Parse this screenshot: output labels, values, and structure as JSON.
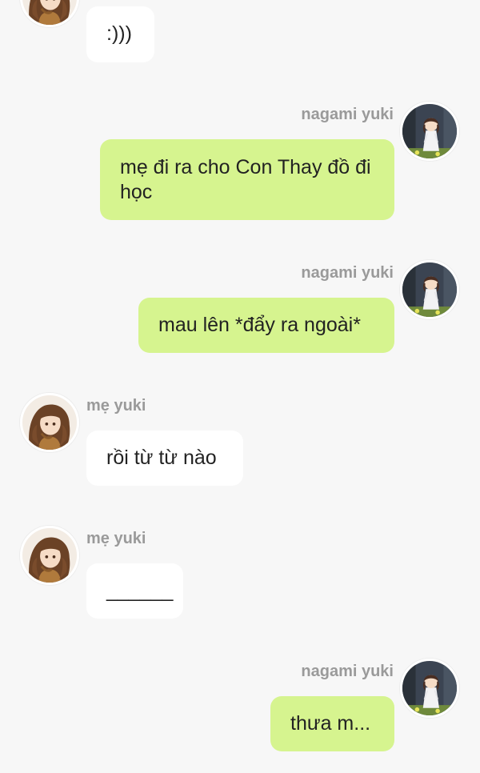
{
  "messages": [
    {
      "sender": "",
      "side": "left",
      "text": ":)))"
    },
    {
      "sender": "nagami yuki",
      "side": "right",
      "text": "mẹ đi ra cho Con Thay đồ đi học"
    },
    {
      "sender": "nagami yuki",
      "side": "right",
      "text": "mau lên *đẩy ra ngoài*"
    },
    {
      "sender": "mẹ yuki",
      "side": "left",
      "text": "rồi từ từ nào"
    },
    {
      "sender": "mẹ yuki",
      "side": "left",
      "text": "______"
    },
    {
      "sender": "nagami yuki",
      "side": "right",
      "text": "thưa m..."
    }
  ],
  "colors": {
    "background": "#f7f7f7",
    "bubble_self": "#d6f48f",
    "bubble_other": "#ffffff",
    "name_text": "#9a9a9a"
  },
  "icons": {
    "mother_avatar": "mother-avatar-icon",
    "user_avatar": "user-avatar-icon"
  }
}
